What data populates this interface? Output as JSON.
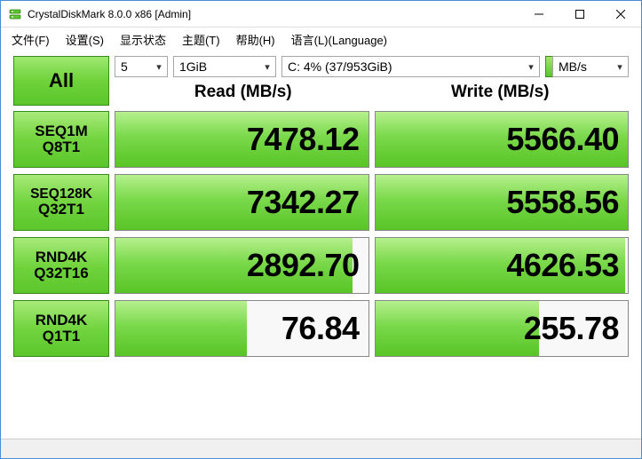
{
  "title": "CrystalDiskMark 8.0.0 x86 [Admin]",
  "menu": {
    "file": "文件(F)",
    "settings": "设置(S)",
    "display": "显示状态",
    "theme": "主题(T)",
    "help": "帮助(H)",
    "language": "语言(L)(Language)"
  },
  "controls": {
    "all_label": "All",
    "loops": "5",
    "size": "1GiB",
    "drive": "C: 4% (37/953GiB)",
    "unit": "MB/s"
  },
  "headers": {
    "read": "Read (MB/s)",
    "write": "Write (MB/s)"
  },
  "tests": [
    {
      "label1": "SEQ1M",
      "label2": "Q8T1",
      "read": {
        "value": "7478.12",
        "fill_pct": 100
      },
      "write": {
        "value": "5566.40",
        "fill_pct": 100
      }
    },
    {
      "label1": "SEQ128K",
      "label2": "Q32T1",
      "small": true,
      "read": {
        "value": "7342.27",
        "fill_pct": 100
      },
      "write": {
        "value": "5558.56",
        "fill_pct": 100
      }
    },
    {
      "label1": "RND4K",
      "label2": "Q32T16",
      "read": {
        "value": "2892.70",
        "fill_pct": 94
      },
      "write": {
        "value": "4626.53",
        "fill_pct": 99
      }
    },
    {
      "label1": "RND4K",
      "label2": "Q1T1",
      "read": {
        "value": "76.84",
        "fill_pct": 52
      },
      "write": {
        "value": "255.78",
        "fill_pct": 65
      }
    }
  ]
}
